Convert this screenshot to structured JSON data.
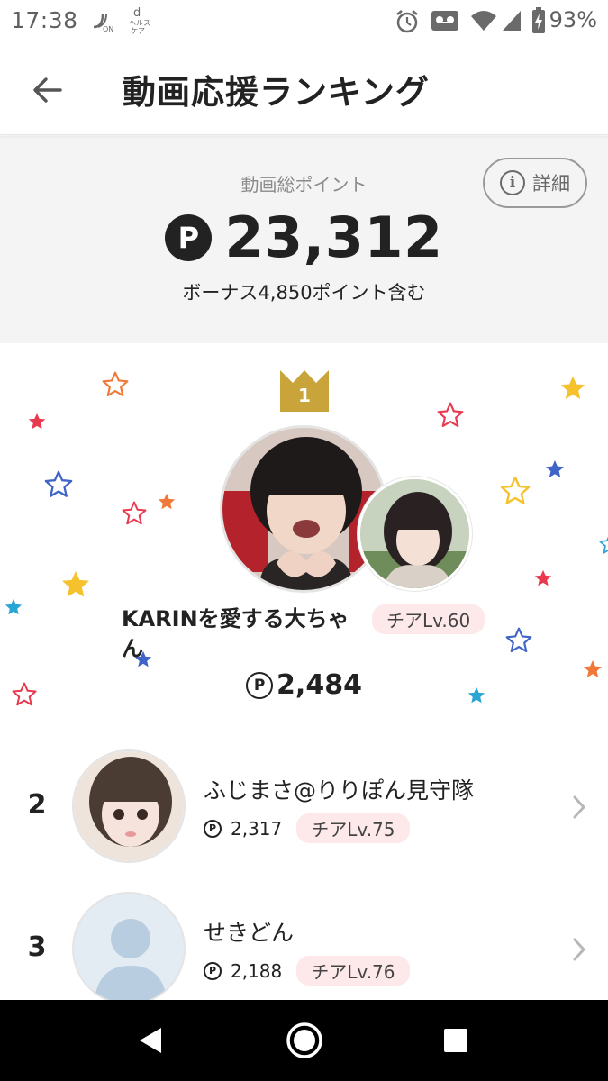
{
  "status_bar": {
    "time": "17:38",
    "battery_percent": "93%",
    "icons": [
      "nfc-on-icon",
      "docomo-health-icon",
      "alarm-icon",
      "voicemail-icon",
      "wifi-icon",
      "signal-icon",
      "battery-charging-icon"
    ]
  },
  "header": {
    "title": "動画応援ランキング",
    "back_icon": "arrow-left-icon"
  },
  "summary": {
    "label": "動画総ポイント",
    "point_symbol": "P",
    "total": "23,312",
    "bonus": "ボーナス4,850ポイント含む",
    "detail_icon_glyph": "i",
    "detail_label": "詳細"
  },
  "first_place": {
    "rank": "1",
    "name": "KARINを愛する大ちゃん",
    "level": "チアLv.60",
    "point_symbol": "P",
    "points": "2,484"
  },
  "ranking": [
    {
      "rank": "2",
      "name": "ふじまさ@りりぽん見守隊",
      "point_symbol": "P",
      "points": "2,317",
      "level": "チアLv.75"
    },
    {
      "rank": "3",
      "name": "せきどん",
      "point_symbol": "P",
      "points": "2,188",
      "level": "チアLv.76"
    }
  ],
  "colors": {
    "crown_gold": "#c9a43a",
    "badge_pink": "#fde8ea",
    "summary_bg": "#f4f4f4",
    "star_red": "#e8394f",
    "star_orange": "#f0793a",
    "star_yellow": "#f5c22e",
    "star_blue": "#3f63c7",
    "star_cyan": "#2aa6d6"
  }
}
